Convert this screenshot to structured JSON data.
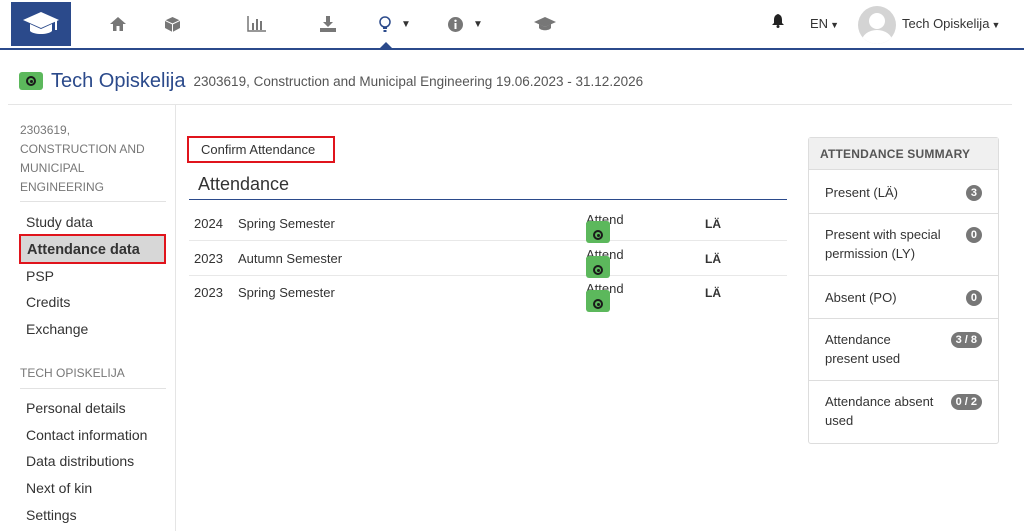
{
  "navbar": {
    "lang": "EN",
    "user": "Tech Opiskelija",
    "icons": [
      "home-icon",
      "cube-icon",
      "bar-chart-icon",
      "download-icon",
      "lightbulb-icon",
      "info-icon",
      "graduation-cap-icon"
    ],
    "accent": "#2b4a8b"
  },
  "title": {
    "name": "Tech Opiskelija",
    "subtitle": "2303619, Construction and Municipal Engineering 19.06.2023 - 31.12.2026"
  },
  "sidebar": {
    "program_heading": "2303619, CONSTRUCTION AND MUNICIPAL ENGINEERING",
    "program_items": [
      "Study data",
      "Attendance data",
      "PSP",
      "Credits",
      "Exchange"
    ],
    "person_heading": "TECH OPISKELIJA",
    "person_items": [
      "Personal details",
      "Contact information",
      "Data distributions",
      "Next of kin",
      "Settings"
    ]
  },
  "main": {
    "confirm_label": "Confirm Attendance",
    "section_title": "Attendance",
    "rows": [
      {
        "year": "2024",
        "semester": "Spring Semester",
        "status": "Attend",
        "code": "LÄ"
      },
      {
        "year": "2023",
        "semester": "Autumn Semester",
        "status": "Attend",
        "code": "LÄ"
      },
      {
        "year": "2023",
        "semester": "Spring Semester",
        "status": "Attend",
        "code": "LÄ"
      }
    ]
  },
  "summary": {
    "heading": "ATTENDANCE SUMMARY",
    "rows": [
      {
        "label": "Present (LÄ)",
        "count": "3"
      },
      {
        "label": "Present with special permission (LY)",
        "count": "0"
      },
      {
        "label": "Absent (PO)",
        "count": "0"
      },
      {
        "label": "Attendance present used",
        "count": "3 / 8"
      },
      {
        "label": "Attendance absent used",
        "count": "0 / 2"
      }
    ]
  },
  "colors": {
    "highlight": "#e0141c",
    "success": "#5cb85c",
    "badge": "#777777"
  }
}
